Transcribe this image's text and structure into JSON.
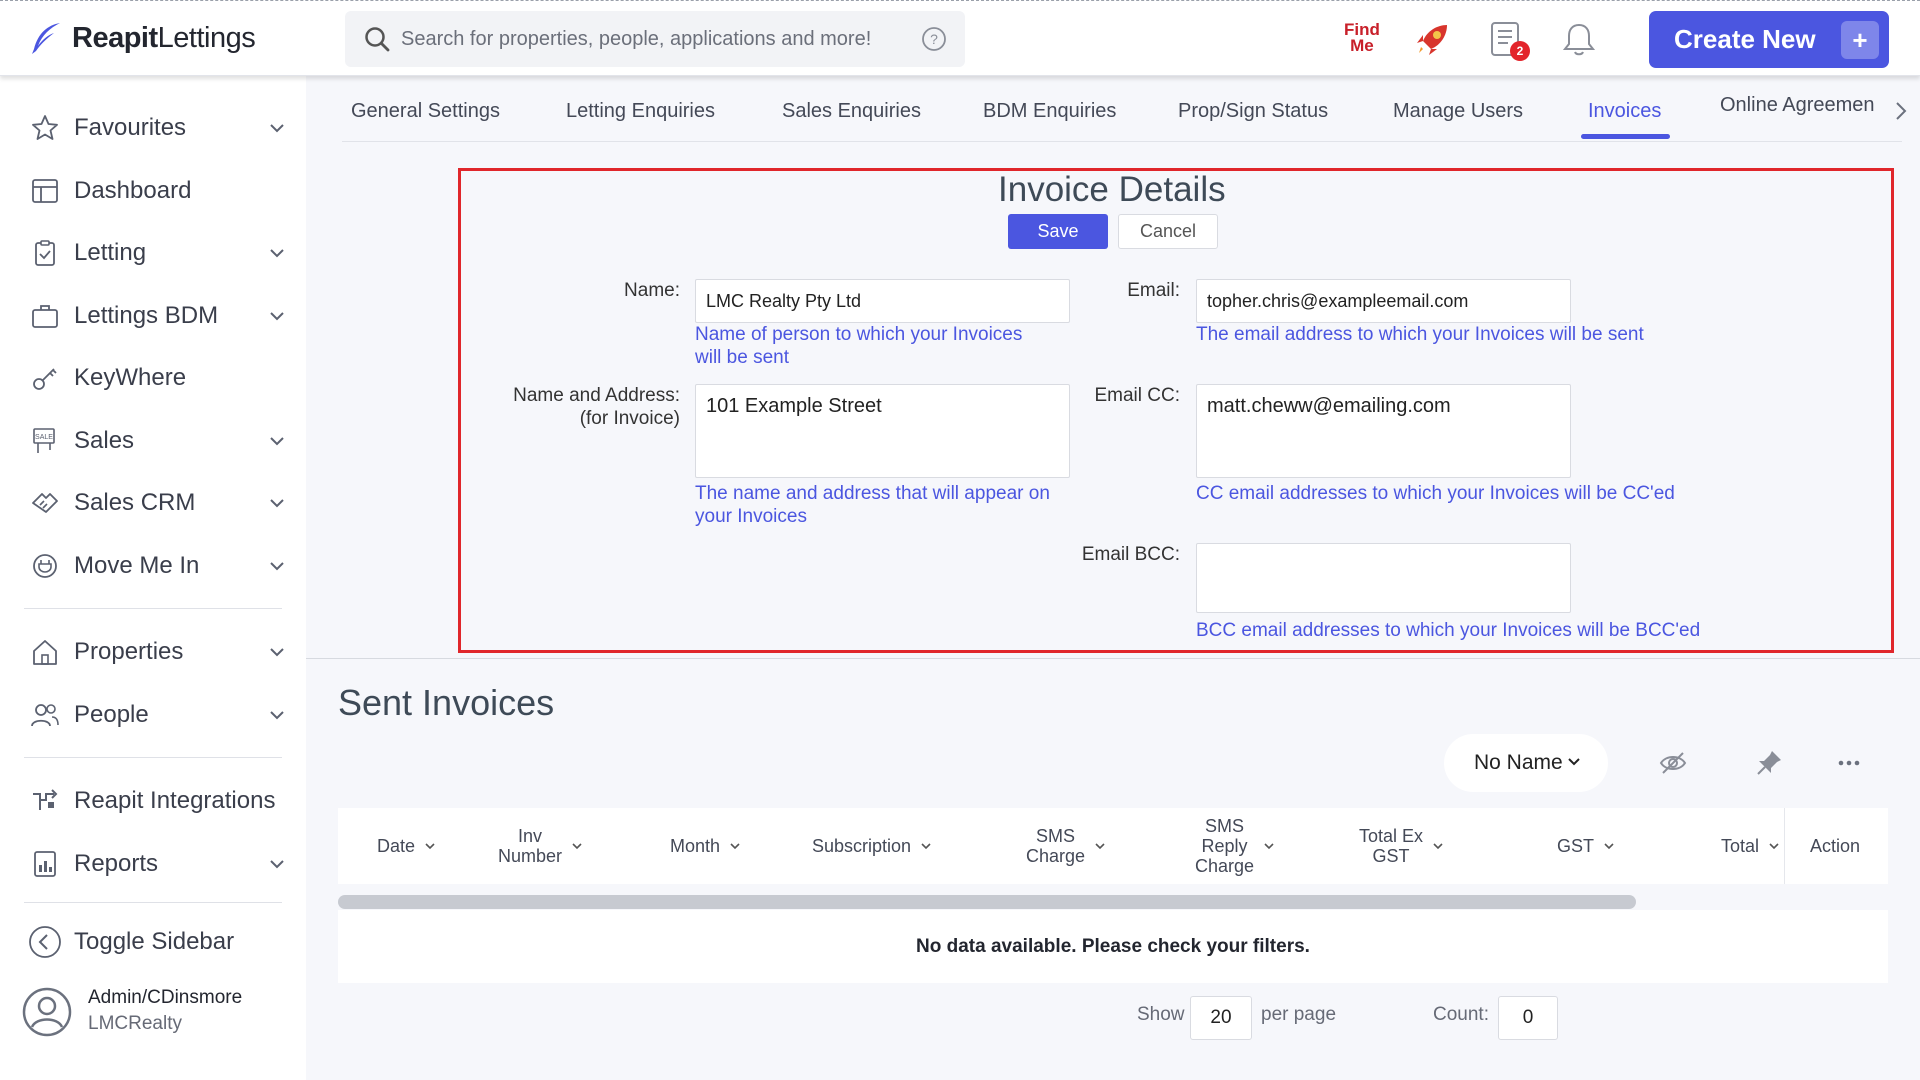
{
  "header": {
    "logo_bold": "Reapit",
    "logo_light": "Lettings",
    "search_placeholder": "Search for properties, people, applications and more!",
    "findme_line1": "Find",
    "findme_line2": "Me",
    "task_badge": "2",
    "create_label": "Create New",
    "create_plus": "+"
  },
  "sidebar": {
    "items": [
      {
        "label": "Favourites",
        "icon": "star-icon"
      },
      {
        "label": "Dashboard",
        "icon": "dashboard-icon"
      },
      {
        "label": "Letting",
        "icon": "clipboard-icon"
      },
      {
        "label": "Lettings BDM",
        "icon": "briefcase-icon"
      },
      {
        "label": "KeyWhere",
        "icon": "key-icon"
      },
      {
        "label": "Sales",
        "icon": "sale-sign-icon"
      },
      {
        "label": "Sales CRM",
        "icon": "handshake-icon"
      },
      {
        "label": "Move Me In",
        "icon": "plug-icon"
      },
      {
        "label": "Properties",
        "icon": "house-icon"
      },
      {
        "label": "People",
        "icon": "people-icon"
      },
      {
        "label": "Reapit Integrations",
        "icon": "integrations-icon"
      },
      {
        "label": "Reports",
        "icon": "reports-icon"
      }
    ],
    "toggle_label": "Toggle Sidebar",
    "user_name": "Admin/CDinsmore",
    "user_org": "LMCRealty"
  },
  "tabs": [
    {
      "label": "General Settings"
    },
    {
      "label": "Letting Enquiries"
    },
    {
      "label": "Sales Enquiries"
    },
    {
      "label": "BDM Enquiries"
    },
    {
      "label": "Prop/Sign Status"
    },
    {
      "label": "Manage Users"
    },
    {
      "label": "Invoices"
    },
    {
      "label": "Online Agreemen"
    }
  ],
  "invoice": {
    "title": "Invoice Details",
    "save_label": "Save",
    "cancel_label": "Cancel",
    "name_label": "Name:",
    "name_value": "LMC Realty Pty Ltd",
    "name_help_1": "Name of person to which your Invoices",
    "name_help_2": "will be sent",
    "addr_label_1": "Name and Address:",
    "addr_label_2": "(for Invoice)",
    "addr_value": "101 Example Street",
    "addr_help_1": "The name and address that will appear on",
    "addr_help_2": "your Invoices",
    "email_label": "Email:",
    "email_value": "topher.chris@exampleemail.com",
    "email_help": "The email address to which your Invoices will be sent",
    "cc_label": "Email CC:",
    "cc_value": "matt.cheww@emailing.com",
    "cc_help": "CC email addresses to which your Invoices will be CC'ed",
    "bcc_label": "Email BCC:",
    "bcc_value": "",
    "bcc_help": "BCC email addresses to which your Invoices will be BCC'ed"
  },
  "sent": {
    "title": "Sent Invoices",
    "view_select": "No Name",
    "columns": [
      {
        "l1": "Date",
        "l2": "",
        "l3": ""
      },
      {
        "l1": "Inv",
        "l2": "Number",
        "l3": ""
      },
      {
        "l1": "Month",
        "l2": "",
        "l3": ""
      },
      {
        "l1": "Subscription",
        "l2": "",
        "l3": ""
      },
      {
        "l1": "SMS",
        "l2": "Charge",
        "l3": ""
      },
      {
        "l1": "SMS",
        "l2": "Reply",
        "l3": "Charge"
      },
      {
        "l1": "Total Ex",
        "l2": "GST",
        "l3": ""
      },
      {
        "l1": "GST",
        "l2": "",
        "l3": ""
      },
      {
        "l1": "Total",
        "l2": "",
        "l3": ""
      },
      {
        "l1": "Action",
        "l2": "",
        "l3": ""
      }
    ],
    "empty_message": "No data available. Please check your filters.",
    "show_label": "Show",
    "per_page_value": "20",
    "per_page_label": "per page",
    "count_label": "Count:",
    "count_value": "0"
  },
  "colors": {
    "accent": "#4b56e0",
    "highlight_border": "#e0262b",
    "badge": "#e3242b",
    "findme": "#c8202a"
  }
}
